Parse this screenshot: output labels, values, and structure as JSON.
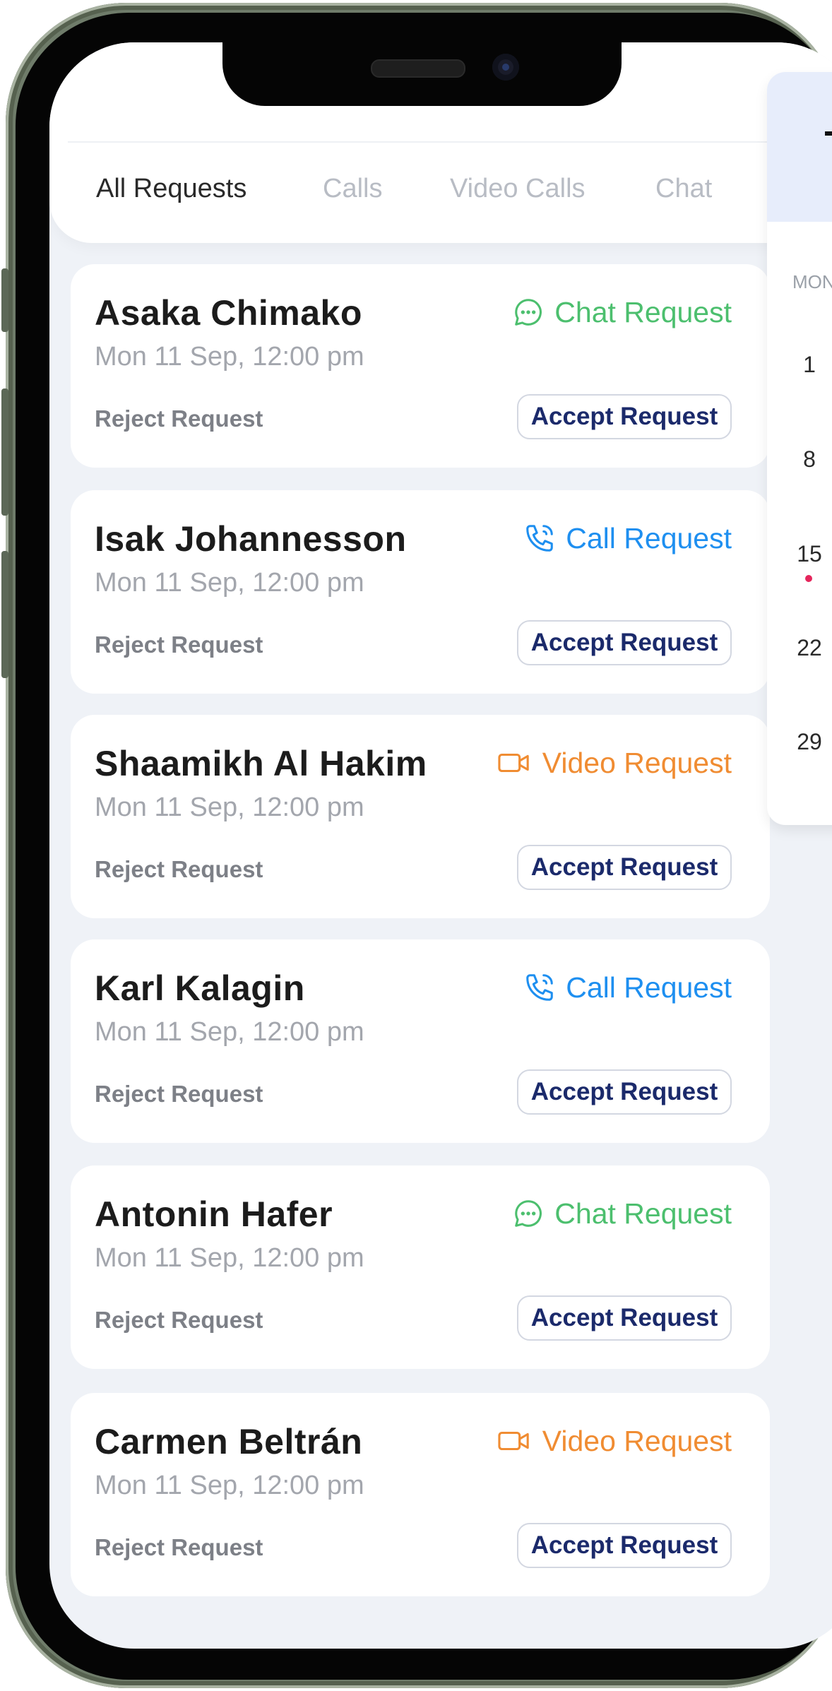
{
  "tabs": [
    {
      "label": "All Requests",
      "active": true
    },
    {
      "label": "Calls",
      "active": false
    },
    {
      "label": "Video Calls",
      "active": false
    },
    {
      "label": "Chat",
      "active": false
    }
  ],
  "requests": [
    {
      "name": "Asaka Chimako",
      "time": "Mon 11 Sep, 12:00 pm",
      "type_label": "Chat Request",
      "type_icon": "chat-icon",
      "reject": "Reject Request",
      "accept": "Accept Request"
    },
    {
      "name": "Isak Johannesson",
      "time": "Mon 11 Sep, 12:00 pm",
      "type_label": "Call Request",
      "type_icon": "phone-icon",
      "reject": "Reject Request",
      "accept": "Accept Request"
    },
    {
      "name": "Shaamikh Al Hakim",
      "time": "Mon 11 Sep, 12:00 pm",
      "type_label": "Video Request",
      "type_icon": "video-icon",
      "reject": "Reject Request",
      "accept": "Accept Request"
    },
    {
      "name": "Karl Kalagin",
      "time": "Mon 11 Sep, 12:00 pm",
      "type_label": "Call Request",
      "type_icon": "phone-icon",
      "reject": "Reject Request",
      "accept": "Accept Request"
    },
    {
      "name": "Antonin Hafer",
      "time": "Mon 11 Sep, 12:00 pm",
      "type_label": "Chat Request",
      "type_icon": "chat-icon",
      "reject": "Reject Request",
      "accept": "Accept Request"
    },
    {
      "name": "Carmen Beltrán",
      "time": "Mon 11 Sep, 12:00 pm",
      "type_label": "Video Request",
      "type_icon": "video-icon",
      "reject": "Reject Request",
      "accept": "Accept Request"
    }
  ],
  "colors": {
    "chat": "#4cbf6e",
    "call": "#1e8ff0",
    "video": "#f08c32",
    "accept_text": "#1b2a6b",
    "event_dot": "#e5265c"
  },
  "calendar": {
    "weekday": "MON",
    "days": [
      "1",
      "8",
      "15",
      "22",
      "29"
    ]
  }
}
